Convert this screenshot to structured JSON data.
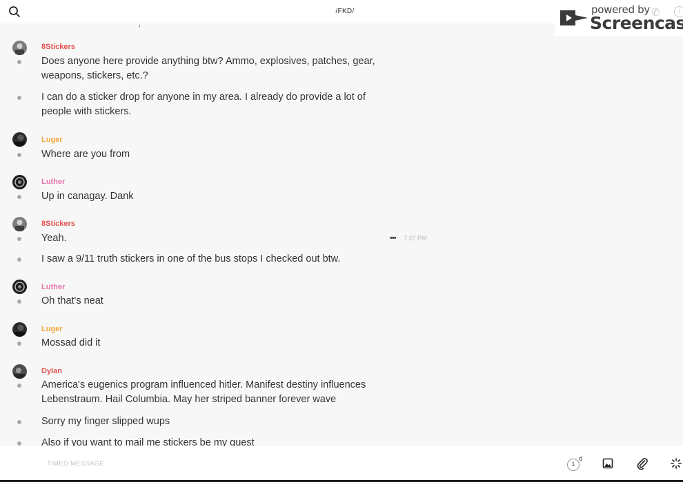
{
  "header": {
    "channel_title": "/FKD/"
  },
  "watermark": {
    "small": "powered by",
    "big": "Screencastify"
  },
  "feed": {
    "cut_text": ",",
    "messages": [
      {
        "username": "8Stickers",
        "text": "Does anyone here provide anything btw? Ammo, explosives, patches, gear, weapons, stickers, etc.?"
      },
      {
        "text": "I can do a sticker drop for anyone in my area. I already do provide a lot of people with stickers."
      },
      {
        "username": "Luger",
        "text": "Where are you from"
      },
      {
        "username": "Luther",
        "text": "Up in canagay. Dank"
      },
      {
        "username": "8Stickers",
        "text": "Yeah.",
        "time": "7:27 PM",
        "menu": "•••"
      },
      {
        "text": "I saw a 9/11 truth stickers in one of the bus stops I checked out btw."
      },
      {
        "username": "Luther",
        "text": "Oh that's neat"
      },
      {
        "username": "Luger",
        "text": "Mossad did it"
      },
      {
        "username": "Dylan",
        "text": "America's eugenics program influenced hitler. Manifest destiny influences Lebenstraum. Hail Columbia. May her striped banner forever wave"
      },
      {
        "text": "Sorry my finger slipped wups"
      },
      {
        "text": "Also if you want to mail me stickers be my guest"
      }
    ]
  },
  "composer": {
    "placeholder": "TIMED MESSAGE",
    "timer_value": "1",
    "timer_unit": "d"
  },
  "colors": {
    "8Stickers": "#e0524f",
    "Luger": "#f0a83c",
    "Luther": "#e576a8",
    "Dylan": "#e0524f"
  }
}
